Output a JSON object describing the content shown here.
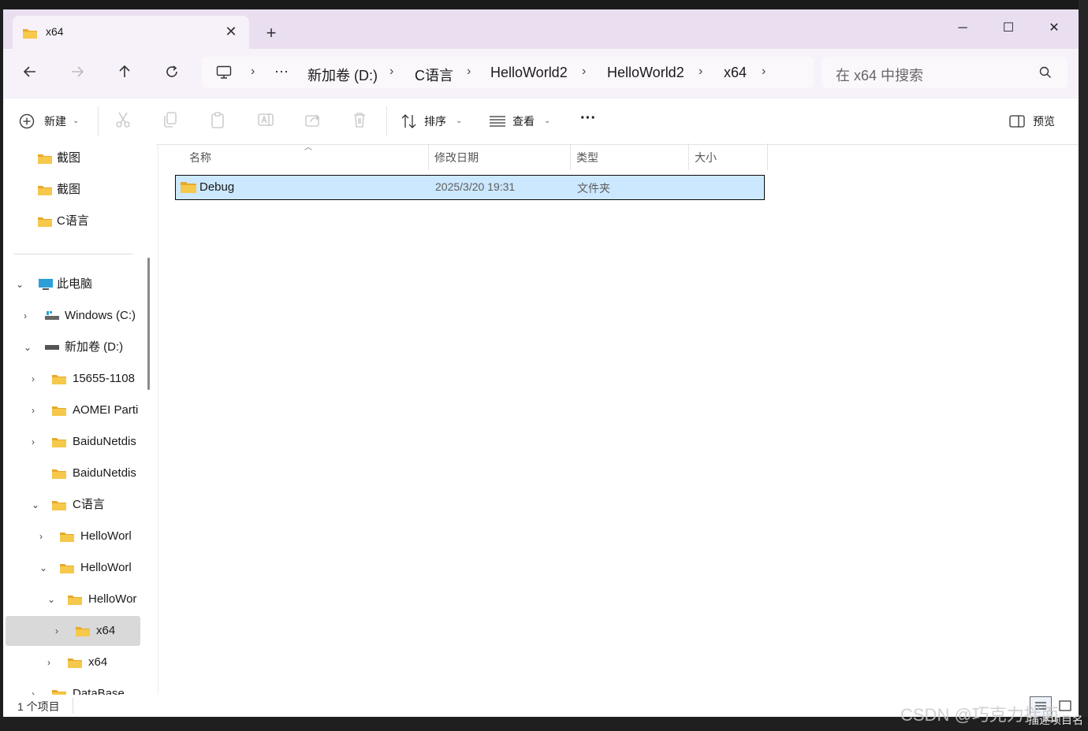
{
  "window": {
    "tab_title": "x64",
    "new_tab_label": "+",
    "tab_close_label": "✕",
    "minimize_label": "─",
    "maximize_label": "☐",
    "close_label": "✕"
  },
  "nav": {
    "back_icon": "arrow-left-icon",
    "forward_icon": "arrow-right-icon",
    "up_icon": "arrow-up-icon",
    "refresh_icon": "refresh-icon"
  },
  "address": {
    "computer_icon": "monitor-icon",
    "more_label": "···",
    "crumbs": [
      "新加卷 (D:)",
      "C语言",
      "HelloWorld2",
      "HelloWorld2",
      "x64"
    ]
  },
  "search": {
    "placeholder": "在 x64 中搜索"
  },
  "toolbar": {
    "new_label": "新建",
    "sort_label": "排序",
    "view_label": "查看",
    "more_label": "···",
    "preview_label": "预览"
  },
  "sidebar": {
    "quick_items": [
      {
        "label": "截图"
      },
      {
        "label": "截图"
      },
      {
        "label": "C语言"
      }
    ],
    "tree": [
      {
        "label": "此电脑",
        "icon": "computer-icon",
        "expanded": true
      },
      {
        "label": "Windows (C:)",
        "icon": "drive-icon",
        "expanded": false
      },
      {
        "label": "新加卷 (D:)",
        "icon": "drive-icon",
        "expanded": true
      },
      {
        "label": "15655-1108",
        "icon": "folder-icon",
        "expanded": false
      },
      {
        "label": "AOMEI Parti",
        "icon": "folder-icon",
        "expanded": false
      },
      {
        "label": "BaiduNetdis",
        "icon": "folder-icon",
        "expanded": false
      },
      {
        "label": "BaiduNetdis",
        "icon": "folder-icon"
      },
      {
        "label": "C语言",
        "icon": "folder-icon",
        "expanded": true
      },
      {
        "label": "HelloWorl",
        "icon": "folder-icon",
        "expanded": false
      },
      {
        "label": "HelloWorl",
        "icon": "folder-icon",
        "expanded": true
      },
      {
        "label": "HelloWor",
        "icon": "folder-icon",
        "expanded": true
      },
      {
        "label": "x64",
        "icon": "folder-icon",
        "expanded": false,
        "selected": true
      },
      {
        "label": "x64",
        "icon": "folder-icon",
        "expanded": false
      },
      {
        "label": "DataBase",
        "icon": "folder-icon",
        "expanded": false
      }
    ]
  },
  "columns": {
    "name": "名称",
    "modified": "修改日期",
    "type": "类型",
    "size": "大小"
  },
  "files": [
    {
      "name": "Debug",
      "modified": "2025/3/20 19:31",
      "type": "文件夹",
      "size": ""
    }
  ],
  "status": {
    "count": "1 个项目"
  },
  "watermark": {
    "text": "CSDN @巧克力拌面",
    "overlay": "描述项目名"
  },
  "colors": {
    "accent": "#0067c0",
    "selection": "#cce8ff",
    "titlebar": "#e9dff0",
    "folder": "#f3c745"
  }
}
